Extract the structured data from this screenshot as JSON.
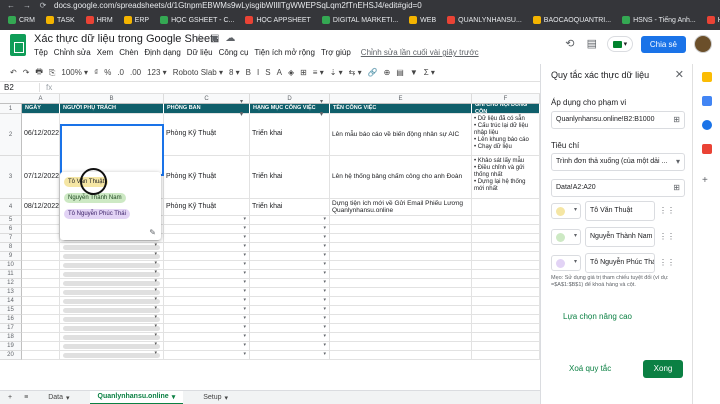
{
  "browser": {
    "url": "docs.google.com/spreadsheets/d/1GtnpmEBWMs9wLyisgibWIlllTgWWEPSqLqm2fTnEHSJ4/edit#gid=0",
    "bookmarks": [
      "CRM",
      "TASK",
      "HRM",
      "ERP",
      "HỌC GSHEET - C...",
      "HỌC APPSHEET",
      "DIGITAL MARKETI...",
      "WEB",
      "QUANLYNHANSU...",
      "BAOCAOQUANTRI...",
      "HSNS - Tiếng Anh...",
      "HSNSnhiphiv"
    ]
  },
  "header": {
    "title": "Xác thực dữ liệu trong Google Sheets",
    "menu": [
      "Tệp",
      "Chỉnh sửa",
      "Xem",
      "Chèn",
      "Định dạng",
      "Dữ liệu",
      "Công cụ",
      "Tiện ích mở rộng",
      "Trợ giúp"
    ],
    "last_edit": "Chỉnh sửa lần cuối vài giây trước",
    "share_label": "Chia sẻ"
  },
  "toolbar": {
    "zoom": "100%",
    "font": "Roboto Slab",
    "items": [
      "↶",
      "↷",
      "🖶",
      "⎘",
      "100% ▾",
      "₫",
      "%",
      ".0",
      ".00",
      "123 ▾",
      "Roboto Slab ▾",
      "8 ▾",
      "B",
      "I",
      "S",
      "A",
      "◈",
      "⊞",
      "≡ ▾",
      "⇣ ▾",
      "⇆ ▾",
      "🔗",
      "⊕",
      "▤",
      "▼",
      "Σ ▾"
    ]
  },
  "formula_bar": {
    "name_box": "B2",
    "fx": "fx"
  },
  "grid": {
    "col_headers": [
      "A",
      "B",
      "C",
      "D",
      "E",
      "F"
    ],
    "header_row": [
      "NGÀY",
      "NGƯỜI PHỤ TRÁCH",
      "PHÒNG BAN",
      "HẠNG MỤC CÔNG VIỆC",
      "TÊN CÔNG VIỆC",
      "GHI CHÚ NỘI DUNG CÔN"
    ],
    "row_numbers": [
      "1",
      "2",
      "3",
      "4",
      "5",
      "6",
      "7",
      "8",
      "9",
      "10",
      "11",
      "12",
      "13",
      "14",
      "15",
      "16",
      "17",
      "18",
      "19",
      "20"
    ],
    "rows": [
      {
        "date": "06/12/2022",
        "dept": "Phòng Kỹ Thuật",
        "category": "Triển khai",
        "task": "Lên mẫu báo cáo về biến động nhân sự AIC",
        "notes": "• Dữ liệu đã có sẵn\n• Cấu trúc lại dữ liệu nhập liệu\n• Lên khung báo cáo\n• Chạy dữ liệu"
      },
      {
        "date": "07/12/2022",
        "dept": "Phòng Kỹ Thuật",
        "category": "Triển khai",
        "task": "Lên hệ thống bảng chấm công cho anh Đoàn",
        "notes": "• Khảo sát lấy mẫu\n• Điều chỉnh và gửi thống nhất\n• Dựng lại hệ thống mới nhất"
      },
      {
        "date": "08/12/2022",
        "dept": "Phòng Kỹ Thuật",
        "category": "Triển khai",
        "task": "Dựng tiện ích mới về Gửi Email Phiếu Lương Quanlynhansu.online",
        "notes": ""
      }
    ],
    "dropdown_options": [
      "Tô Văn Thuật",
      "Nguyễn Thành Nam",
      "Tô Nguyễn Phúc Thái"
    ]
  },
  "sheet_tabs": [
    "Data",
    "Quanlynhansu.online",
    "Setup"
  ],
  "panel": {
    "title": "Quy tắc xác thực dữ liệu",
    "apply_label": "Áp dụng cho phạm vi",
    "range": "Quanlynhansu.online!B2:B1000",
    "criteria_label": "Tiêu chí",
    "criteria": "Trình đơn thả xuống (của một dải ...",
    "source_range": "Data!A2:A20",
    "options": [
      {
        "label": "Tô Văn Thuật",
        "color": "#f5e6a4"
      },
      {
        "label": "Nguyễn Thành Nam",
        "color": "#cde9c4"
      },
      {
        "label": "Tô Nguyễn Phúc Thá",
        "color": "#e2d3f5"
      }
    ],
    "tip": "Mẹo: Sử dụng giá trị tham chiếu tuyệt đối (ví dụ: =$A$1:$B$1) để khoá hàng và cột.",
    "advanced": "Lựa chọn nâng cao",
    "remove": "Xoá quy tắc",
    "done": "Xong"
  },
  "colors": {
    "header_teal": "#0f5f6b",
    "accent_green": "#0b8043",
    "share_blue": "#1a73e8"
  }
}
